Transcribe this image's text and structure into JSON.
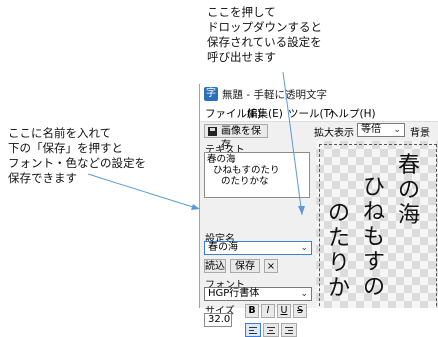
{
  "callouts": {
    "top": [
      "ここを押して",
      "ドロップダウンすると",
      "保存されている設定を",
      "呼び出せます"
    ],
    "left": [
      "ここに名前を入れて",
      "下の「保存」を押すと",
      "フォント・色などの設定を",
      "保存できます"
    ]
  },
  "app": {
    "icon_char": "字",
    "title": "無題 - 手軽に透明文字",
    "menu": {
      "file": "ファイル(F)",
      "edit": "編集(E)",
      "tool": "ツール(T)",
      "help": "ヘルプ(H)"
    }
  },
  "left_panel": {
    "save_image_label": "画像を保存",
    "text_label": "テキスト",
    "text_lines": [
      "春の海",
      "ひねもすのたり",
      "のたりかな"
    ],
    "setting_name_label": "設定名",
    "setting_name_value": "春の海",
    "load_label": "読込",
    "save_label": "保存",
    "delete_label": "×",
    "font_label": "フォント",
    "font_value": "HGP行書体",
    "size_label": "サイズ",
    "size_value": "32.0",
    "bold": "B",
    "italic": "I",
    "underline": "U",
    "strike": "S"
  },
  "preview_toolbar": {
    "zoom_label": "拡大表示",
    "zoom_value": "等倍",
    "bg_label": "背景"
  },
  "preview": {
    "columns": [
      "春の海",
      "ひねもすの",
      "のたりか"
    ]
  },
  "colors": {
    "callout_line": "#5b9bd5",
    "accent": "#3b7dd8"
  }
}
